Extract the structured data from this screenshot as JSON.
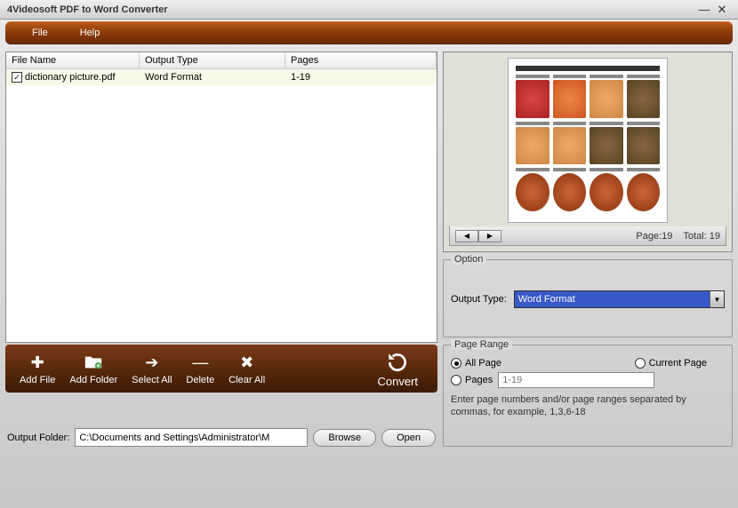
{
  "window": {
    "title": "4Videosoft PDF to Word Converter"
  },
  "menu": {
    "file": "File",
    "help": "Help"
  },
  "filelist": {
    "headers": {
      "name": "File Name",
      "type": "Output Type",
      "pages": "Pages"
    },
    "rows": [
      {
        "checked": true,
        "name": "dictionary picture.pdf",
        "type": "Word Format",
        "pages": "1-19"
      }
    ]
  },
  "toolbar": {
    "add_file": "Add File",
    "add_folder": "Add Folder",
    "select_all": "Select All",
    "delete": "Delete",
    "clear_all": "Clear All",
    "convert": "Convert"
  },
  "output": {
    "label": "Output Folder:",
    "path": "C:\\Documents and Settings\\Administrator\\M",
    "browse": "Browse",
    "open": "Open"
  },
  "preview": {
    "page_label": "Page:",
    "page_value": "19",
    "total_label": "Total:",
    "total_value": "19"
  },
  "option": {
    "title": "Option",
    "output_type_label": "Output Type:",
    "output_type_value": "Word Format"
  },
  "range": {
    "title": "Page Range",
    "all": "All Page",
    "current": "Current Page",
    "pages": "Pages",
    "placeholder": "1-19",
    "hint": "Enter page numbers and/or page ranges separated by commas, for example, 1,3,6-18"
  }
}
